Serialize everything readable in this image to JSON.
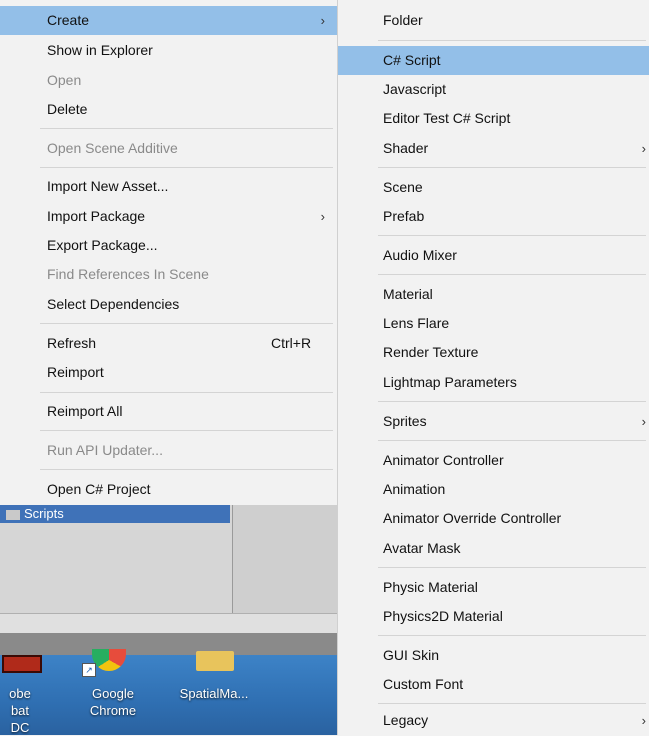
{
  "context_menu": {
    "items": [
      {
        "label": "Create",
        "arrow": "›",
        "highlight": true
      },
      {
        "label": "Show in Explorer"
      },
      {
        "label": "Open",
        "disabled": true
      },
      {
        "label": "Delete"
      },
      {
        "label": "Open Scene Additive",
        "disabled": true
      },
      {
        "label": "Import New Asset..."
      },
      {
        "label": "Import Package",
        "arrow": "›"
      },
      {
        "label": "Export Package..."
      },
      {
        "label": "Find References In Scene",
        "disabled": true
      },
      {
        "label": "Select Dependencies"
      },
      {
        "label": "Refresh",
        "shortcut": "Ctrl+R"
      },
      {
        "label": "Reimport"
      },
      {
        "label": "Reimport All"
      },
      {
        "label": "Run API Updater...",
        "disabled": true
      },
      {
        "label": "Open C# Project"
      }
    ]
  },
  "create_submenu": {
    "items": [
      {
        "label": "Folder"
      },
      {
        "label": "C# Script",
        "highlight": true
      },
      {
        "label": "Javascript"
      },
      {
        "label": "Editor Test C# Script"
      },
      {
        "label": "Shader",
        "arrow": "›"
      },
      {
        "label": "Scene"
      },
      {
        "label": "Prefab"
      },
      {
        "label": "Audio Mixer"
      },
      {
        "label": "Material"
      },
      {
        "label": "Lens Flare"
      },
      {
        "label": "Render Texture"
      },
      {
        "label": "Lightmap Parameters"
      },
      {
        "label": "Sprites",
        "arrow": "›"
      },
      {
        "label": "Animator Controller"
      },
      {
        "label": "Animation"
      },
      {
        "label": "Animator Override Controller"
      },
      {
        "label": "Avatar Mask"
      },
      {
        "label": "Physic Material"
      },
      {
        "label": "Physics2D Material"
      },
      {
        "label": "GUI Skin"
      },
      {
        "label": "Custom Font"
      },
      {
        "label": "Legacy",
        "arrow": "›"
      }
    ]
  },
  "project_panel": {
    "selected_folder": "Scripts"
  },
  "desktop": {
    "icons": [
      {
        "label_line1": "obe",
        "label_line2": "bat DC"
      },
      {
        "label_line1": "Google",
        "label_line2": "Chrome"
      },
      {
        "label_line1": "SpatialMa...",
        "label_line2": ""
      }
    ]
  },
  "colors": {
    "highlight": "#93bfe8",
    "menu_bg": "#f2f2f2",
    "disabled_text": "#8a8a8a",
    "desktop_blue": "#2f6fb2"
  }
}
